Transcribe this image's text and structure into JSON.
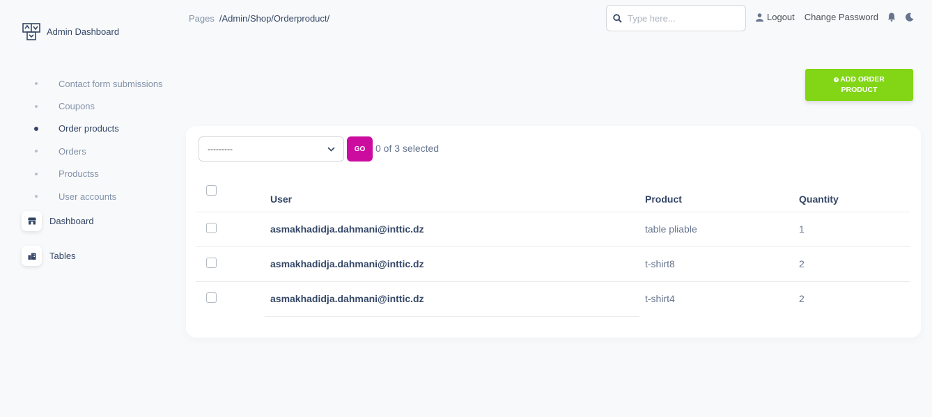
{
  "brand": {
    "title": "Admin Dashboard"
  },
  "breadcrumb": {
    "pages": "Pages",
    "path": "/Admin/Shop/Orderproduct/"
  },
  "search": {
    "placeholder": "Type here..."
  },
  "topnav": {
    "logout": "Logout",
    "change_password": "Change Password"
  },
  "sidebar": {
    "items": [
      {
        "label": "Contact form submissions",
        "active": false
      },
      {
        "label": "Coupons",
        "active": false
      },
      {
        "label": "Order products",
        "active": true
      },
      {
        "label": "Orders",
        "active": false
      },
      {
        "label": "Productss",
        "active": false
      },
      {
        "label": "User accounts",
        "active": false
      }
    ],
    "dashboard": "Dashboard",
    "tables": "Tables"
  },
  "add_button": {
    "line1": "ADD ORDER",
    "line2": "PRODUCT"
  },
  "actions": {
    "selected_value": "---------",
    "go": "GO",
    "count": "0 of 3 selected"
  },
  "table": {
    "headers": {
      "user": "User",
      "product": "Product",
      "quantity": "Quantity"
    },
    "rows": [
      {
        "user": "asmakhadidja.dahmani@inttic.dz",
        "product": "table pliable",
        "quantity": "1"
      },
      {
        "user": "asmakhadidja.dahmani@inttic.dz",
        "product": "t-shirt8",
        "quantity": "2"
      },
      {
        "user": "asmakhadidja.dahmani@inttic.dz",
        "product": "t-shirt4",
        "quantity": "2"
      }
    ]
  },
  "colors": {
    "accent_green": "#82d616",
    "accent_pink": "#cb0c9f",
    "text_dark": "#344767"
  }
}
